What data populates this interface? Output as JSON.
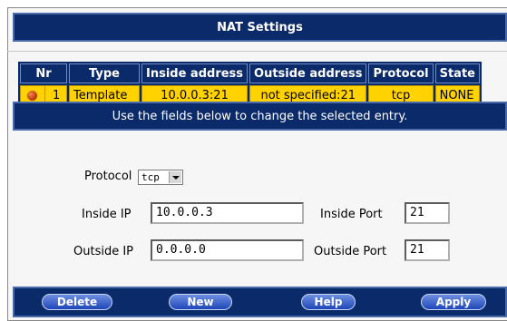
{
  "header": {
    "title": "NAT Settings"
  },
  "table": {
    "columns": [
      "Nr",
      "Type",
      "Inside address",
      "Outside address",
      "Protocol",
      "State"
    ],
    "rows": [
      {
        "nr": "1",
        "type": "Template",
        "inside": "10.0.0.3:21",
        "outside": "not specified:21",
        "protocol": "tcp",
        "state": "NONE"
      }
    ]
  },
  "info": {
    "message": "Use the fields below to change the selected entry."
  },
  "form": {
    "protocol_label": "Protocol",
    "protocol_value": "tcp",
    "inside_ip_label": "Inside IP",
    "inside_ip_value": "10.0.0.3",
    "inside_port_label": "Inside Port",
    "inside_port_value": "21",
    "outside_ip_label": "Outside IP",
    "outside_ip_value": "0.0.0.0",
    "outside_port_label": "Outside Port",
    "outside_port_value": "21"
  },
  "footer": {
    "delete_label": "Delete",
    "new_label": "New",
    "help_label": "Help",
    "apply_label": "Apply"
  },
  "colors": {
    "navy": "#0b2a6a",
    "yellow": "#ffd200",
    "button": "#1f46b8"
  }
}
